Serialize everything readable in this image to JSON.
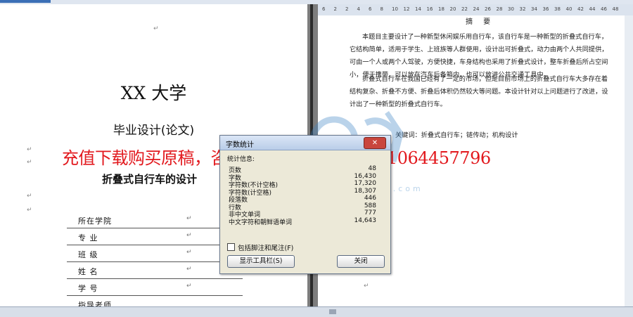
{
  "left_page": {
    "title": "XX 大学",
    "subtitle": "毕业设计(论文)",
    "thesis_title": "折叠式自行车的设计",
    "fields": [
      {
        "label": "所在学院"
      },
      {
        "label": "专      业"
      },
      {
        "label": "班      级"
      },
      {
        "label": "姓      名"
      },
      {
        "label": "学      号"
      },
      {
        "label": "指导老师"
      }
    ],
    "para_mark": "↵"
  },
  "ruler": {
    "ticks": [
      "6",
      "2",
      "2",
      "4",
      "6",
      "8",
      "10",
      "12",
      "14",
      "16",
      "18",
      "20",
      "22",
      "24",
      "26",
      "28",
      "30",
      "32",
      "34",
      "36",
      "38",
      "40",
      "42",
      "44",
      "46",
      "48"
    ]
  },
  "right_page": {
    "abstract_title": "摘 要",
    "paragraphs": [
      "本题目主要设计了一种新型休闲娱乐用自行车，该自行车是一种新型的折叠式自行车，它结构简单，适用于学生、上班族等人群使用，设计出可折叠式，动力由两个人共同提供，可由一个人或两个人驾驶，方便快捷，车身结构也采用了折叠式设计，整车折叠后所占空间小，便于携带，可以放在汽车后备箱内，也可以放进公共交通工具中。",
      "折叠式自行车在我国已经有了一定的市场，但是目前市场上的折叠式自行车大多存在着结构复杂、折叠不方便、折叠后体积仍然较大等问题。本设计针对以上问题进行了改进，设计出了一种新型的折叠式自行车。"
    ],
    "keywords": "关键词：折叠式自行车；链传动；机构设计"
  },
  "promo": "充值下载购买原稿，咨询扣扣414951605或1064457796",
  "watermark": {
    "domain": "www.zhurendo.com"
  },
  "dialog": {
    "title": "字数统计",
    "close_x": "✕",
    "stats_header": "统计信息:",
    "stats": [
      {
        "label": "页数",
        "value": "48"
      },
      {
        "label": "字数",
        "value": "16,430"
      },
      {
        "label": "字符数(不计空格)",
        "value": "17,320"
      },
      {
        "label": "字符数(计空格)",
        "value": "18,307"
      },
      {
        "label": "段落数",
        "value": "446"
      },
      {
        "label": "行数",
        "value": "588"
      },
      {
        "label": "非中文单词",
        "value": "777"
      },
      {
        "label": "中文字符和朝鲜语单词",
        "value": "14,643"
      }
    ],
    "checkbox_label": "包括脚注和尾注(F)",
    "toolbar_button": "显示工具栏(S)",
    "close_button": "关闭"
  },
  "colors": {
    "promo_red": "#e2191e",
    "dialog_bg": "#ece9d8",
    "close_red": "#c9463d"
  }
}
